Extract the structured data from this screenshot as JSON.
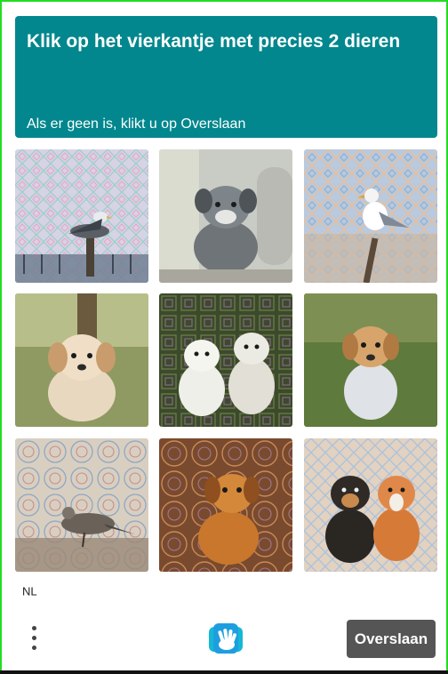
{
  "challenge": {
    "title": "Klik op het vierkantje met precies 2 dieren",
    "subtitle": "Als er geen is, klikt u op Overslaan"
  },
  "tiles": [
    {
      "name": "tile-seagull-1",
      "subject": "seagull",
      "animal_count": 1
    },
    {
      "name": "tile-dog-1",
      "subject": "dog",
      "animal_count": 1
    },
    {
      "name": "tile-seagull-2",
      "subject": "seagull",
      "animal_count": 1
    },
    {
      "name": "tile-dog-2",
      "subject": "dog",
      "animal_count": 1
    },
    {
      "name": "tile-two-dogs-1",
      "subject": "two dogs",
      "animal_count": 2
    },
    {
      "name": "tile-dog-3",
      "subject": "dog",
      "animal_count": 1
    },
    {
      "name": "tile-bird-1",
      "subject": "bird",
      "animal_count": 1
    },
    {
      "name": "tile-dog-4",
      "subject": "dog",
      "animal_count": 1
    },
    {
      "name": "tile-two-dogs-2",
      "subject": "two dogs",
      "animal_count": 2
    }
  ],
  "footer": {
    "language": "NL",
    "skip_label": "Overslaan",
    "menu_icon": "vertical-ellipsis-icon",
    "logo_icon": "hcaptcha-hand-logo"
  },
  "colors": {
    "accent": "#01878d",
    "frame_border": "#22dd22",
    "skip_button": "#555555"
  }
}
